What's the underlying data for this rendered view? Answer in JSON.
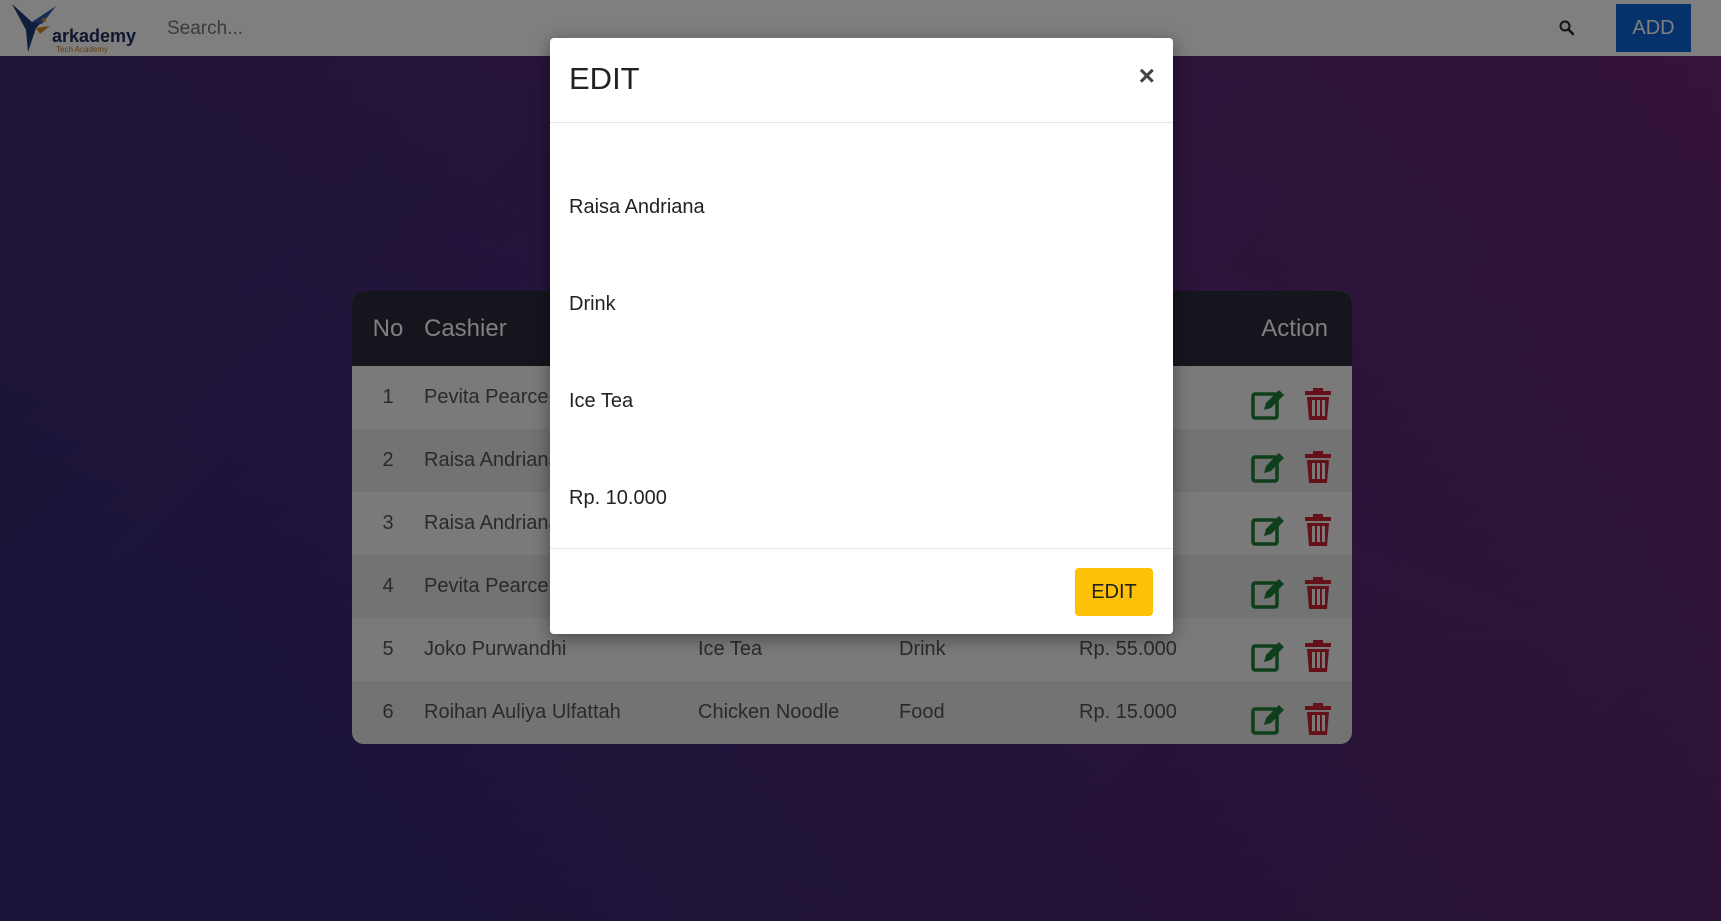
{
  "app": {
    "brand": "arkademy",
    "brand_sub": "Tech Academy"
  },
  "navbar": {
    "search_placeholder": "Search...",
    "search_icon": "search-icon",
    "add_label": "ADD"
  },
  "table": {
    "headers": {
      "no": "No",
      "cashier": "Cashier",
      "action": "Action"
    },
    "rows": [
      {
        "no": "1",
        "cashier": "Pevita Pearce",
        "product": "",
        "category": "",
        "price": ""
      },
      {
        "no": "2",
        "cashier": "Raisa Andriana",
        "product": "",
        "category": "",
        "price": ""
      },
      {
        "no": "3",
        "cashier": "Raisa Andriana",
        "product": "",
        "category": "",
        "price": ""
      },
      {
        "no": "4",
        "cashier": "Pevita Pearce",
        "product": "",
        "category": "",
        "price": ""
      },
      {
        "no": "5",
        "cashier": "Joko Purwandhi",
        "product": "Ice Tea",
        "category": "Drink",
        "price": "Rp. 55.000"
      },
      {
        "no": "6",
        "cashier": "Roihan Auliya Ulfattah",
        "product": "Chicken Noodle",
        "category": "Food",
        "price": "Rp. 15.000"
      }
    ],
    "edit_icon": "edit-icon",
    "delete_icon": "trash-icon",
    "colors": {
      "edit": "#1e7e34",
      "delete": "#c82333",
      "header_bg": "#2a2a3a"
    }
  },
  "modal": {
    "title": "EDIT",
    "close_label": "×",
    "fields": {
      "cashier": "Raisa Andriana",
      "category": "Drink",
      "product": "Ice Tea",
      "price": "Rp. 10.000"
    },
    "submit_label": "EDIT",
    "submit_color": "#ffc107"
  }
}
